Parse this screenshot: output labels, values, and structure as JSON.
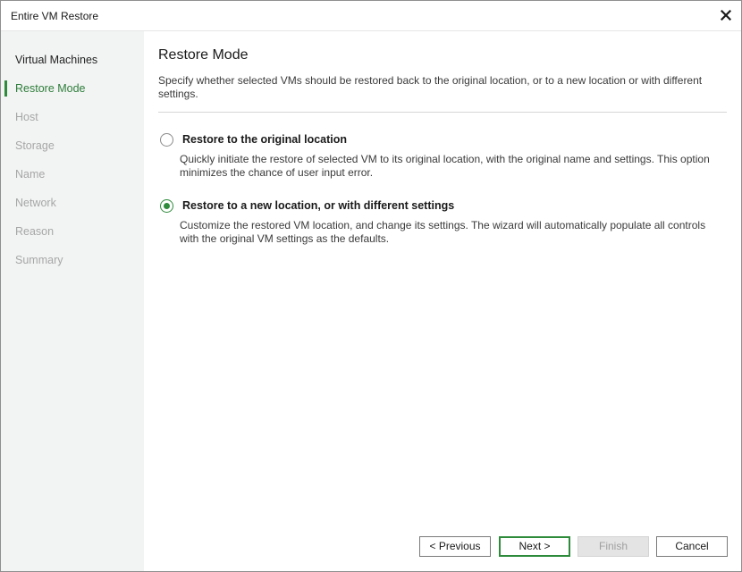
{
  "window": {
    "title": "Entire VM Restore",
    "close_icon": "close-icon"
  },
  "steps": [
    {
      "label": "Virtual Machines",
      "state": "done"
    },
    {
      "label": "Restore Mode",
      "state": "active"
    },
    {
      "label": "Host",
      "state": "pending"
    },
    {
      "label": "Storage",
      "state": "pending"
    },
    {
      "label": "Name",
      "state": "pending"
    },
    {
      "label": "Network",
      "state": "pending"
    },
    {
      "label": "Reason",
      "state": "pending"
    },
    {
      "label": "Summary",
      "state": "pending"
    }
  ],
  "page": {
    "title": "Restore Mode",
    "description": "Specify whether selected VMs should be restored back to the original location, or to a new location or with different settings."
  },
  "options": [
    {
      "label": "Restore to the original location",
      "description": "Quickly initiate the restore of selected VM to its original location, with the original name and settings. This option minimizes the chance of user input error.",
      "selected": false
    },
    {
      "label": "Restore to a new location, or with different settings",
      "description": "Customize the restored VM location, and change its settings. The wizard will automatically populate all controls with the original VM settings as the defaults.",
      "selected": true
    }
  ],
  "buttons": {
    "previous": "< Previous",
    "next": "Next >",
    "finish": "Finish",
    "cancel": "Cancel"
  },
  "colors": {
    "accent": "#2e8b3c",
    "sidebar_bg": "#f2f4f3",
    "disabled_text": "#a6a6a6"
  }
}
